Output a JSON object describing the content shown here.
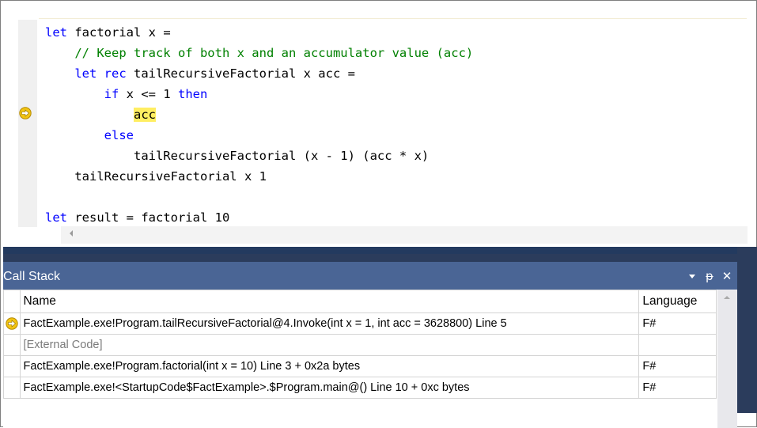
{
  "editor": {
    "lines": [
      {
        "indent": "",
        "tokens": [
          {
            "t": "let",
            "c": "kw"
          },
          {
            "t": " factorial x =",
            "c": ""
          }
        ]
      },
      {
        "indent": "    ",
        "tokens": [
          {
            "t": "// Keep track of both x and an accumulator value (acc)",
            "c": "cm"
          }
        ]
      },
      {
        "indent": "    ",
        "tokens": [
          {
            "t": "let",
            "c": "kw"
          },
          {
            "t": " ",
            "c": ""
          },
          {
            "t": "rec",
            "c": "kw"
          },
          {
            "t": " tailRecursiveFactorial x acc =",
            "c": ""
          }
        ]
      },
      {
        "indent": "        ",
        "tokens": [
          {
            "t": "if",
            "c": "kw"
          },
          {
            "t": " x <= 1 ",
            "c": ""
          },
          {
            "t": "then",
            "c": "kw"
          }
        ]
      },
      {
        "indent": "            ",
        "tokens": [
          {
            "t": "acc",
            "c": "hl"
          }
        ]
      },
      {
        "indent": "        ",
        "tokens": [
          {
            "t": "else",
            "c": "kw"
          }
        ]
      },
      {
        "indent": "            ",
        "tokens": [
          {
            "t": "tailRecursiveFactorial (x - 1) (acc * x)",
            "c": ""
          }
        ]
      },
      {
        "indent": "    ",
        "tokens": [
          {
            "t": "tailRecursiveFactorial x 1",
            "c": ""
          }
        ]
      },
      {
        "indent": "",
        "tokens": []
      },
      {
        "indent": "",
        "tokens": [
          {
            "t": "let",
            "c": "kw"
          },
          {
            "t": " result = factorial 10",
            "c": ""
          }
        ]
      }
    ],
    "current_line_index": 4,
    "icons": {
      "instruction_pointer": "yellow-arrow-icon",
      "scroll_left": "scroll-left-arrow-icon"
    }
  },
  "callstack": {
    "title": "Call Stack",
    "buttons": {
      "dropdown": "▾",
      "pin": "ᵽ",
      "close": "✕"
    },
    "columns": {
      "name": "Name",
      "language": "Language"
    },
    "rows": [
      {
        "current": true,
        "external": false,
        "name": "FactExample.exe!Program.tailRecursiveFactorial@4.Invoke(int x = 1, int acc = 3628800) Line 5",
        "language": "F#"
      },
      {
        "current": false,
        "external": true,
        "name": "[External Code]",
        "language": ""
      },
      {
        "current": false,
        "external": false,
        "name": "FactExample.exe!Program.factorial(int x = 10) Line 3 + 0x2a bytes",
        "language": "F#"
      },
      {
        "current": false,
        "external": false,
        "name": "FactExample.exe!<StartupCode$FactExample>.$Program.main@() Line 10 + 0xc bytes",
        "language": "F#"
      }
    ]
  },
  "colors": {
    "keyword": "#0000ff",
    "comment": "#008000",
    "highlight": "#ffee62",
    "titlebar": "#4a6595",
    "splitter": "#233a5f"
  }
}
